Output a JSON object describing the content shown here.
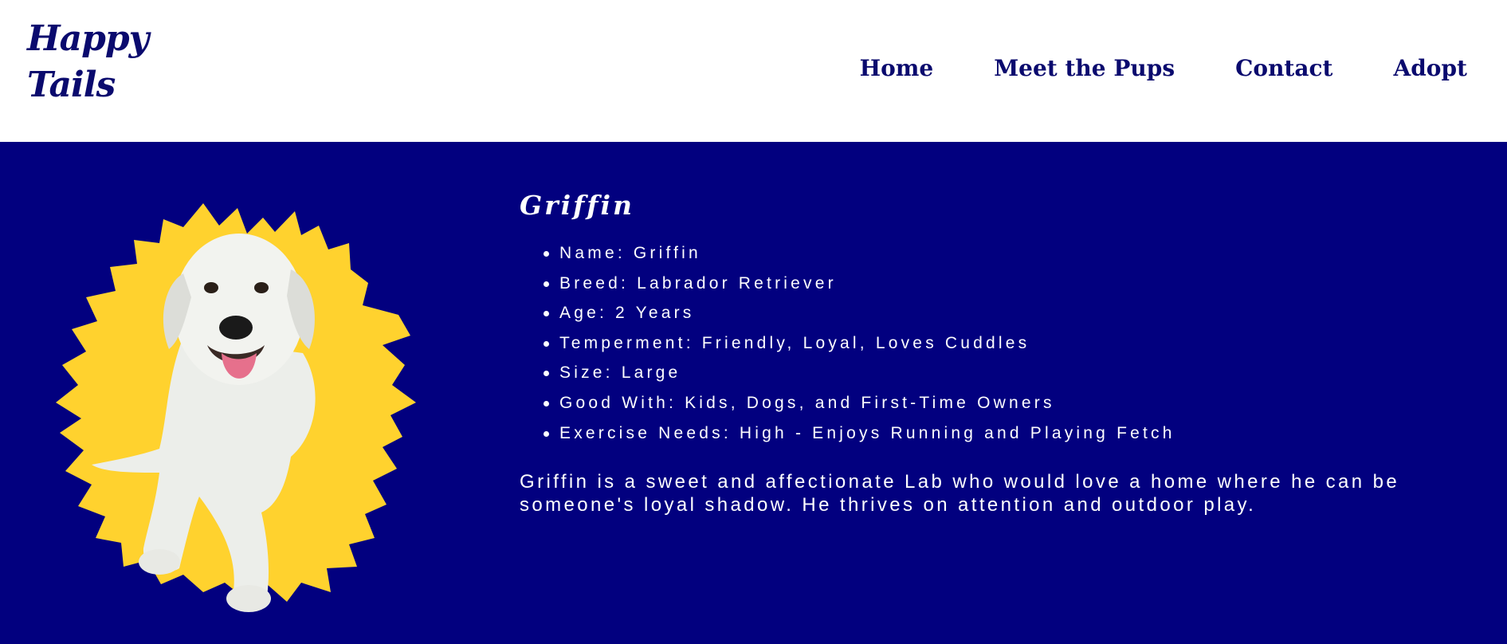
{
  "header": {
    "logo": "Happy Tails",
    "nav": [
      "Home",
      "Meet the Pups",
      "Contact",
      "Adopt"
    ]
  },
  "pup": {
    "name": "Griffin",
    "facts": [
      "Name: Griffin",
      "Breed: Labrador Retriever",
      "Age: 2 Years",
      "Temperment: Friendly, Loyal, Loves Cuddles",
      "Size: Large",
      "Good With: Kids, Dogs, and First-Time Owners",
      "Exercise Needs: High - Enjoys Running and Playing Fetch"
    ],
    "bio": "Griffin is a sweet and affectionate Lab who would love a home where he can be someone's loyal shadow. He thrives on attention and outdoor play."
  },
  "colors": {
    "navy": "#02007f",
    "logo_text": "#0a0a6e",
    "splash_yellow": "#ffd22e",
    "white": "#ffffff"
  },
  "icons": {
    "hero_image": "labrador-dog-on-yellow-paint-splash"
  }
}
